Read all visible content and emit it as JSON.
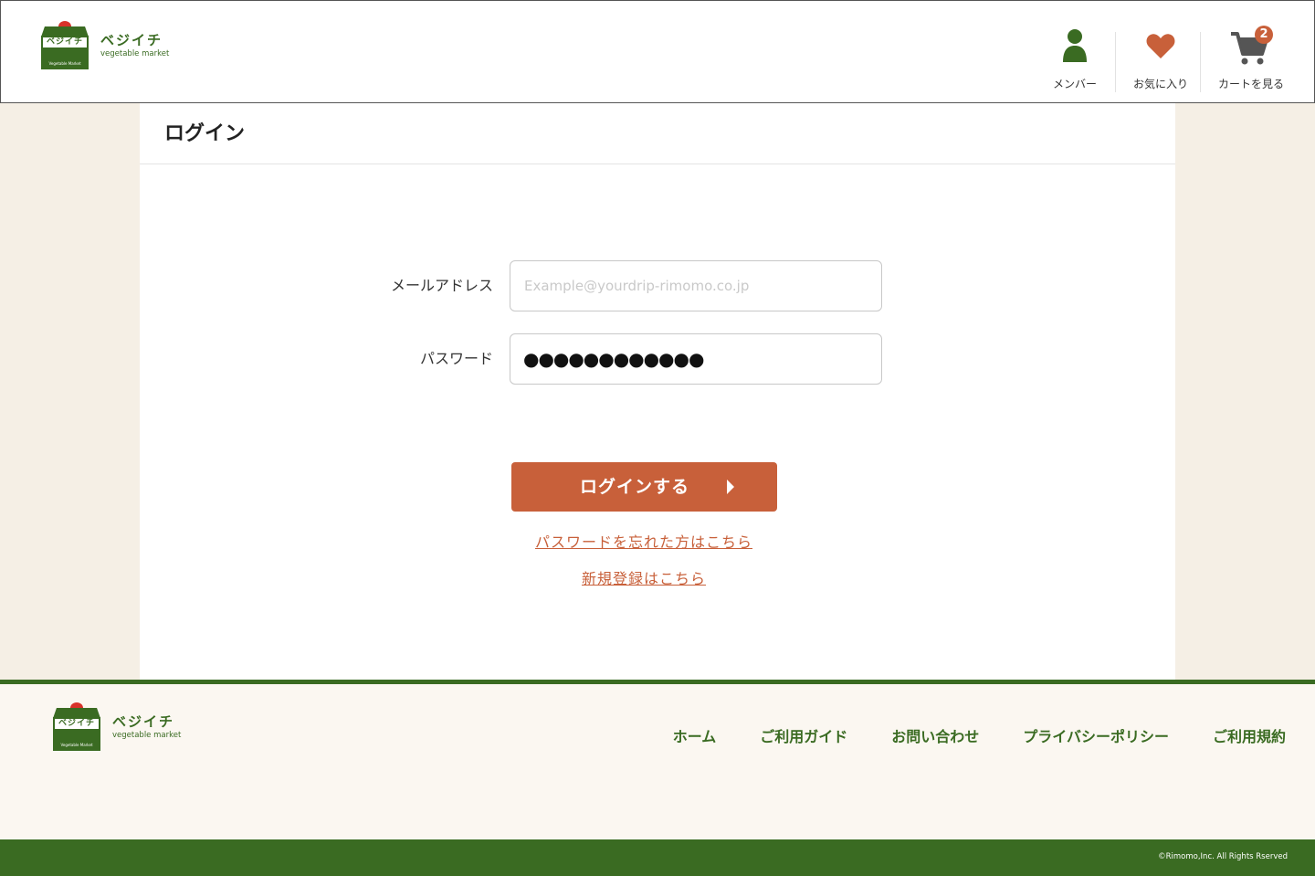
{
  "brand": {
    "name_jp": "ベジイチ",
    "name_en": "vegetable market",
    "sign_text": "ベジイチ",
    "stall_text": "Vegetable Market"
  },
  "header_nav": {
    "member": "メンバー",
    "favorites": "お気に入り",
    "cart": "カートを見る",
    "cart_count": "2"
  },
  "page": {
    "title": "ログイン"
  },
  "form": {
    "email_label": "メールアドレス",
    "email_placeholder": "Example@yourdrip-rimomo.co.jp",
    "email_value": "",
    "password_label": "パスワード",
    "password_value": "●●●●●●●●●●●●",
    "submit_label": "ログインする",
    "forgot_link": "パスワードを忘れた方はこちら",
    "register_link": "新規登録はこちら"
  },
  "footer": {
    "nav": [
      "ホーム",
      "ご利用ガイド",
      "お問い合わせ",
      "プライバシーポリシー",
      "ご利用規約"
    ],
    "copyright": "©Rimomo,Inc. All Rights Rserved"
  },
  "colors": {
    "brand_green": "#3a6b22",
    "accent_orange": "#c8603a",
    "background_beige": "#f5efe5",
    "badge": "#c8603a"
  },
  "icons": {
    "member": "person-icon",
    "favorites": "heart-icon",
    "cart": "cart-icon",
    "submit": "triangle-right-icon"
  }
}
